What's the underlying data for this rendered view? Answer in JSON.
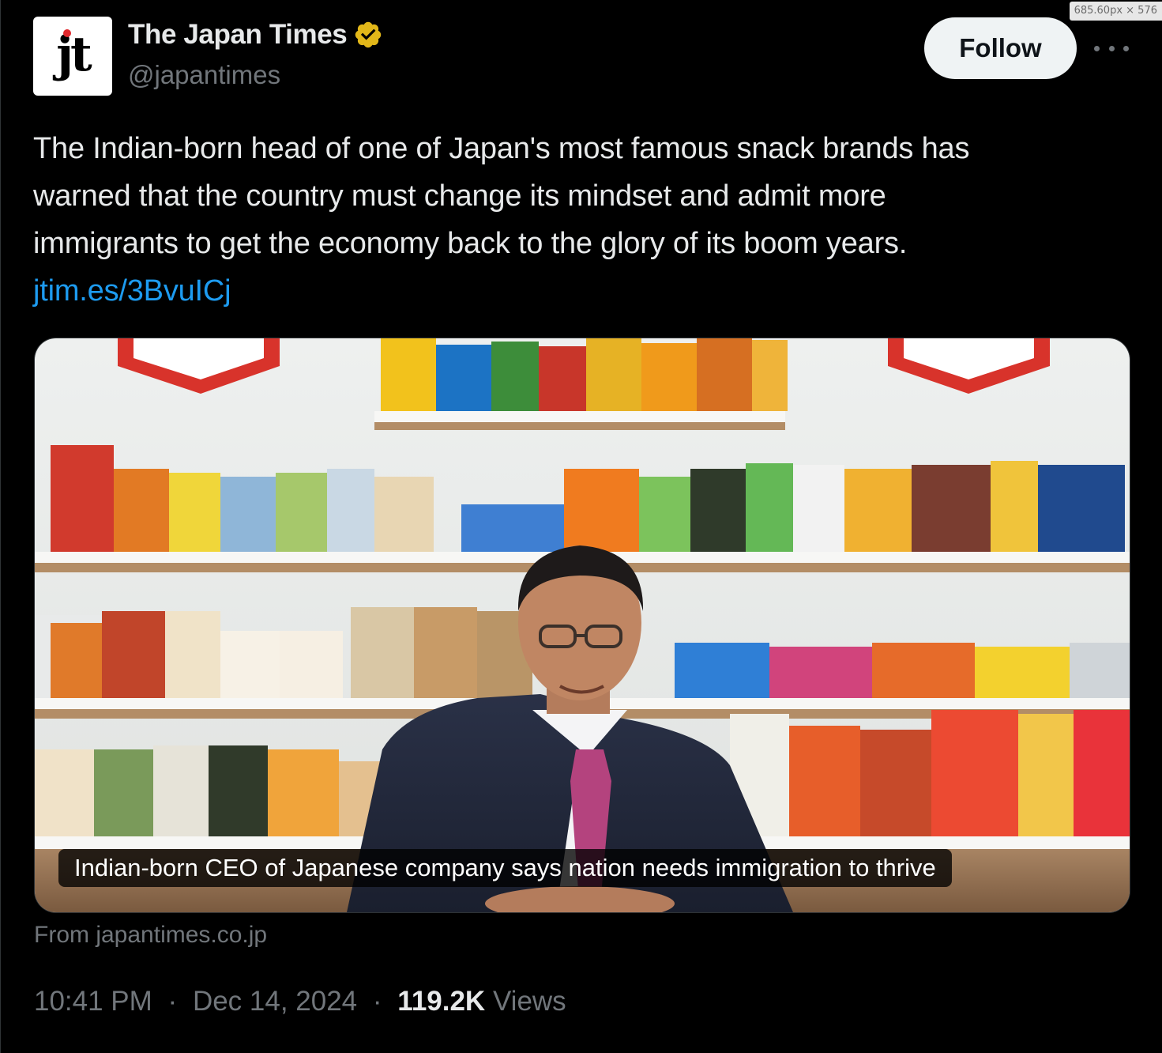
{
  "overlay": {
    "dimensions_badge": "685.60px × 576"
  },
  "author": {
    "name": "The Japan Times",
    "handle": "@japantimes",
    "avatar_text": "jt",
    "verified_icon": "verified-gold-badge",
    "verified_color": "#e2b719"
  },
  "actions": {
    "follow_label": "Follow",
    "more_icon": "more-horizontal-icon"
  },
  "tweet": {
    "lines": [
      "The Indian-born head of one of Japan's most famous snack brands has",
      "warned that the country must change its mindset and admit more",
      "immigrants to get the economy back to the glory of its boom years."
    ],
    "link": "jtim.es/3BvuICj"
  },
  "card": {
    "caption": "Indian-born CEO of Japanese company says nation needs immigration to thrive",
    "source": "From japantimes.co.jp",
    "image_description_icon": "photo-ceo-snack-shelves"
  },
  "meta": {
    "time": "10:41 PM",
    "separator": "·",
    "date": "Dec 14, 2024",
    "views_count": "119.2K",
    "views_label": "Views"
  },
  "colors": {
    "background": "#000000",
    "text_primary": "#e7e9ea",
    "text_secondary": "#71767b",
    "link": "#1d9bf0",
    "follow_bg": "#eff3f4"
  }
}
